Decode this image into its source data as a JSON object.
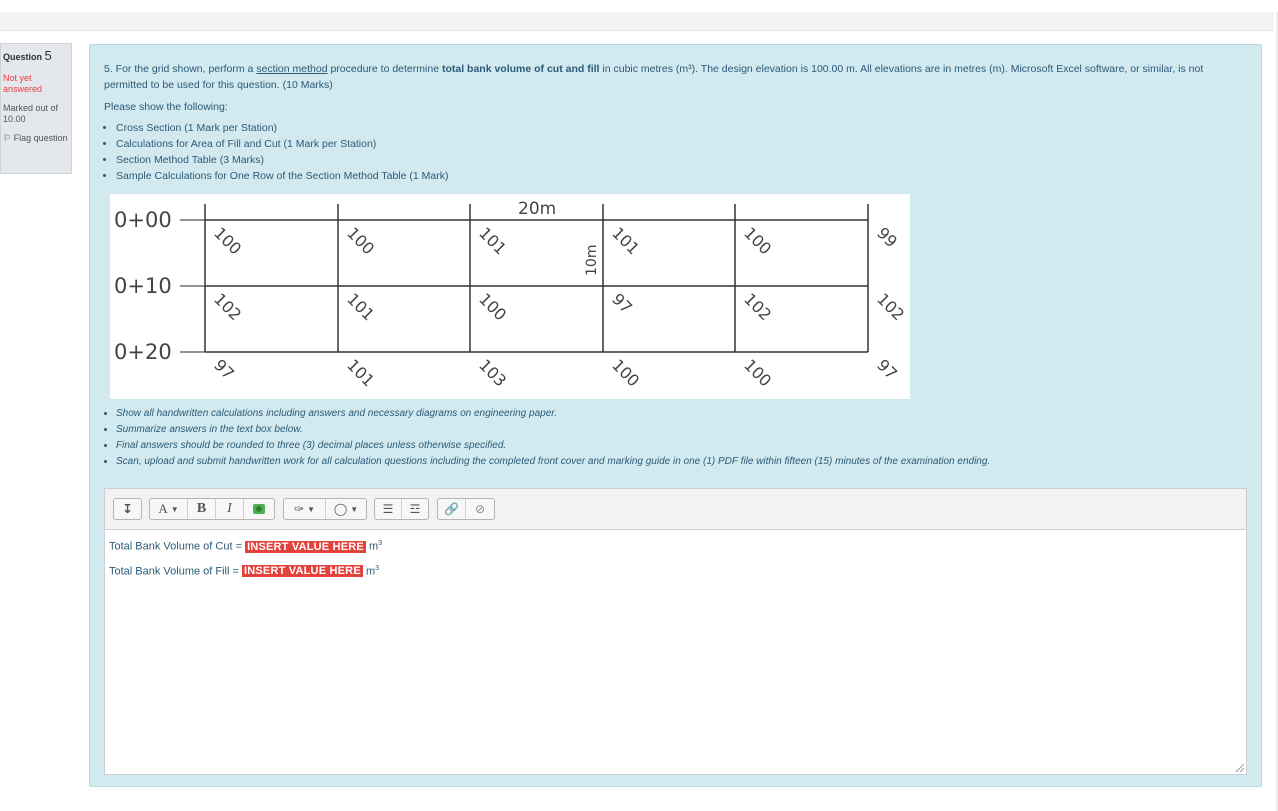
{
  "question_info": {
    "label": "Question",
    "number": "5",
    "state": "Not yet answered",
    "grade": "Marked out of 10.00",
    "flag": "Flag question"
  },
  "question": {
    "intro_prefix": "5. For the grid shown, perform a ",
    "intro_link": "section method",
    "intro_middle": " procedure to determine ",
    "intro_bold": "total bank volume of cut and fill",
    "intro_suffix": " in cubic metres (m³). The design elevation is 100.00 m. All elevations are in metres (m). Microsoft Excel software, or similar, is not permitted to be used for this question. (10 Marks)",
    "show_following": "Please show the following:",
    "items": [
      "Cross Section (1 Mark per Station)",
      "Calculations for Area of Fill and Cut (1 Mark per Station)",
      "Section Method Table (3 Marks)",
      "Sample Calculations for One Row of the Section Method Table (1 Mark)"
    ],
    "instructions": [
      "Show all handwritten calculations including answers and necessary diagrams on engineering paper.",
      "Summarize answers in the text box below.",
      "Final answers should be rounded to three (3) decimal places unless otherwise specified.",
      "Scan, upload and submit handwritten work for all calculation questions including the completed front cover and marking guide in one (1) PDF file within fifteen (15) minutes of the examination ending."
    ]
  },
  "grid": {
    "stations": [
      "0+00",
      "0+10",
      "0+20"
    ],
    "spacing_label": "20m",
    "row_spacing_label": "10m",
    "elevations": [
      [
        "100",
        "100",
        "101",
        "101",
        "100",
        "99"
      ],
      [
        "102",
        "101",
        "100",
        "97",
        "102",
        "102"
      ],
      [
        "97",
        "101",
        "103",
        "100",
        "100",
        "97"
      ]
    ]
  },
  "editor": {
    "toolbar_icons": [
      "show-more-icon",
      "font-size-icon",
      "bold-icon",
      "italic-icon",
      "image-icon",
      "text-color-icon",
      "highlight-icon",
      "bullet-list-icon",
      "numbered-list-icon",
      "link-icon",
      "unlink-icon"
    ],
    "toolbar_labels": {
      "bold": "B",
      "italic": "I",
      "font": "A"
    },
    "cut_label": "Total Bank Volume of Cut = ",
    "fill_label": "Total Bank Volume of Fill = ",
    "placeholder": "INSERT VALUE HERE",
    "unit": "m",
    "unit_sup": "3"
  }
}
